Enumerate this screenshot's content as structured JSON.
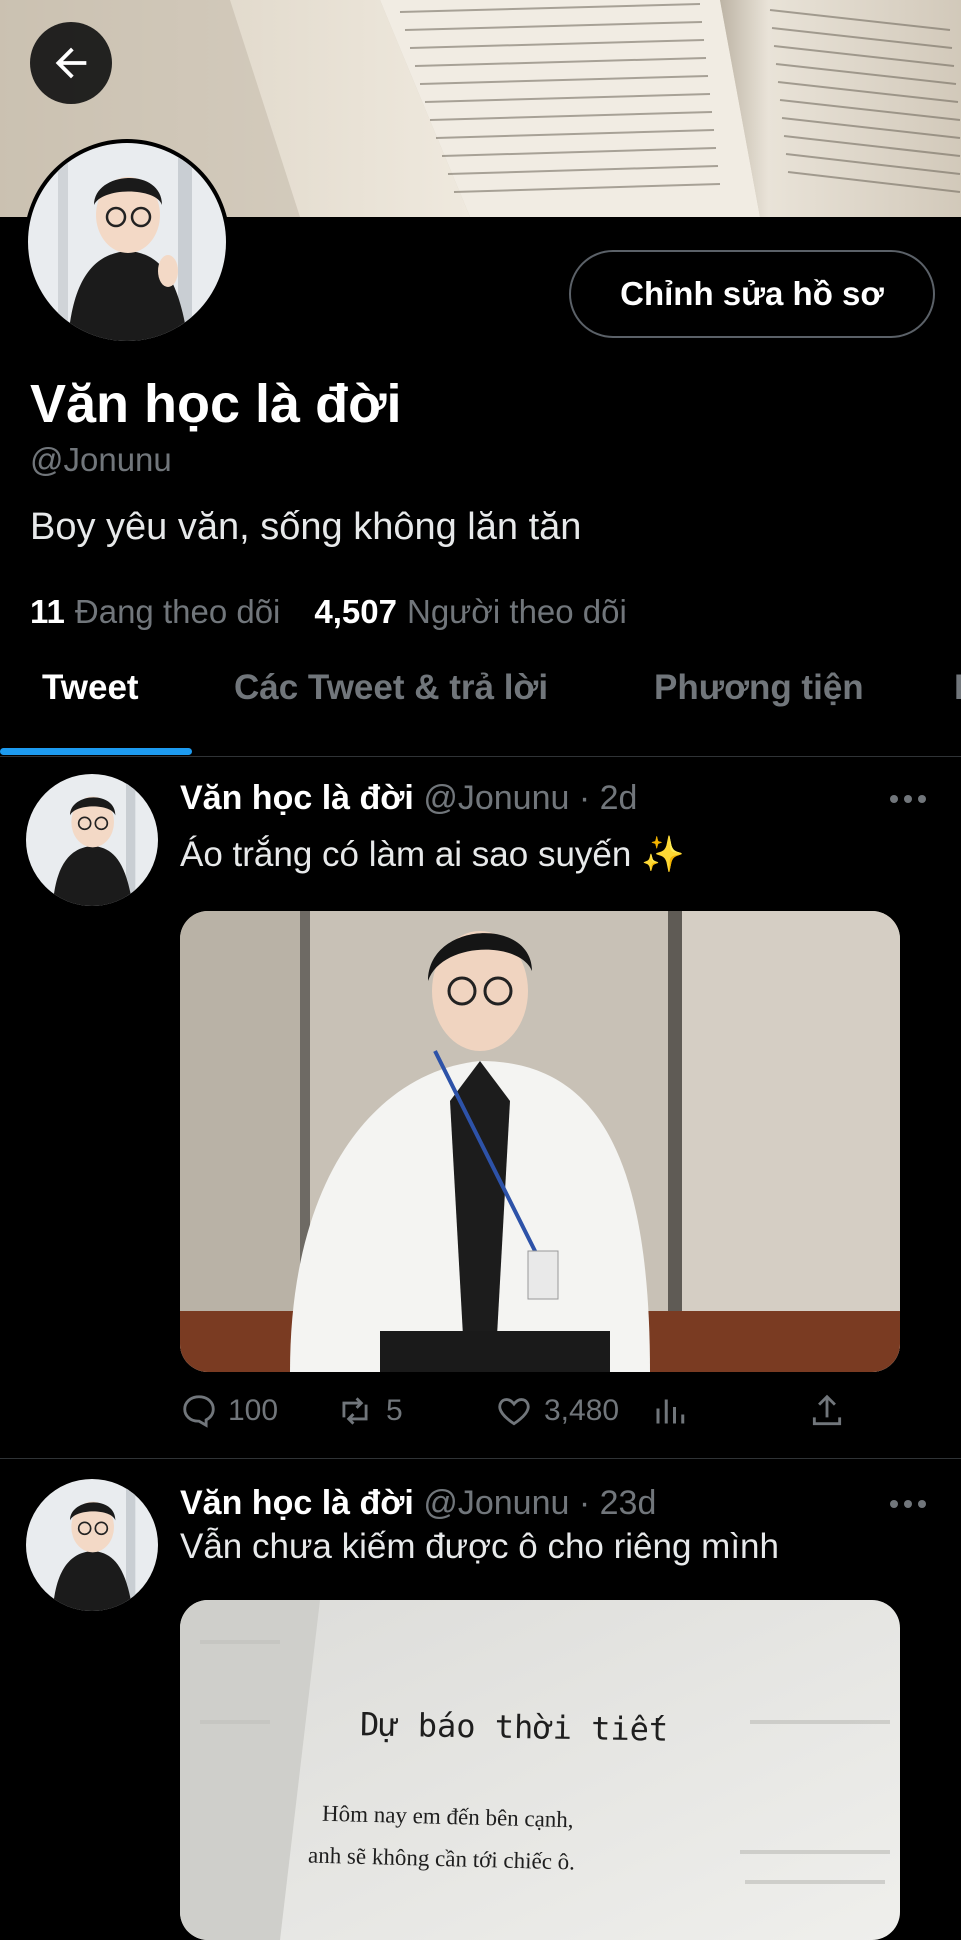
{
  "profile": {
    "display_name": "Văn học là đời",
    "handle": "@Jonunu",
    "bio": "Boy yêu văn, sống không lăn tăn",
    "edit_button": "Chỉnh sửa hồ sơ",
    "following_count": "11",
    "following_label": "Đang theo dõi",
    "followers_count": "4,507",
    "followers_label": "Người theo dõi"
  },
  "tabs": [
    {
      "label": "Tweet",
      "active": true
    },
    {
      "label": "Các Tweet & trả lời",
      "active": false
    },
    {
      "label": "Phương tiện",
      "active": false
    }
  ],
  "tweets": [
    {
      "name": "Văn học là đời",
      "handle": "@Jonunu",
      "time": "· 2d",
      "text": "Áo trắng có làm ai sao suyến ✨",
      "replies": "100",
      "retweets": "5",
      "likes": "3,480"
    },
    {
      "name": "Văn học là đời",
      "handle": "@Jonunu",
      "time": "· 23d",
      "text": "Vẫn chưa kiếm được ô cho riêng mình",
      "media_title": "Dự báo thời tiết",
      "media_line1": "Hôm nay em đến bên cạnh,",
      "media_line2": "anh sẽ không cần tới chiếc ô."
    }
  ],
  "colors": {
    "accent": "#1d9bf0",
    "muted": "#71767b",
    "border": "#2f3336",
    "background": "#000000"
  },
  "icons": {
    "back": "arrow-left-icon",
    "more": "more-horizontal-icon",
    "reply": "speech-bubble-icon",
    "retweet": "retweet-icon",
    "like": "heart-icon",
    "views": "bar-chart-icon",
    "share": "share-upload-icon"
  }
}
